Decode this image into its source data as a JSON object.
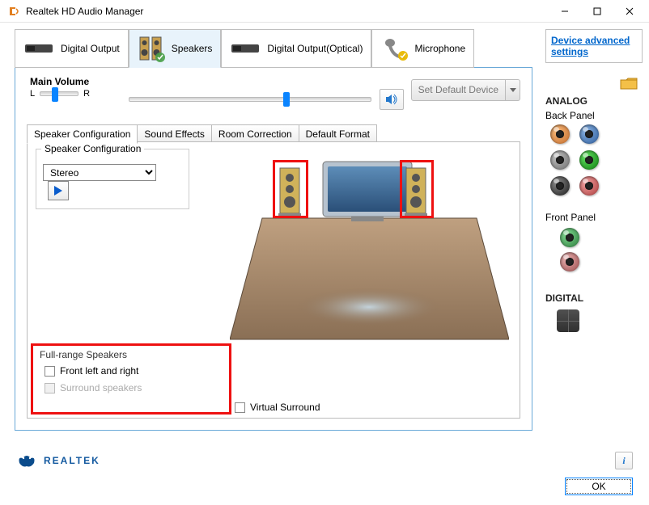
{
  "titlebar": {
    "title": "Realtek HD Audio Manager"
  },
  "device_tabs": [
    {
      "label": "Digital Output",
      "active": false
    },
    {
      "label": "Speakers",
      "active": true
    },
    {
      "label": "Digital Output(Optical)",
      "active": false
    },
    {
      "label": "Microphone",
      "active": false
    }
  ],
  "right": {
    "link": "Device advanced settings",
    "analog_hdr": "ANALOG",
    "back_panel": "Back Panel",
    "front_panel": "Front Panel",
    "digital_hdr": "DIGITAL"
  },
  "volume": {
    "main_label": "Main Volume",
    "left": "L",
    "right": "R",
    "set_default": "Set Default Device"
  },
  "sub_tabs": [
    "Speaker Configuration",
    "Sound Effects",
    "Room Correction",
    "Default Format"
  ],
  "spk_conf": {
    "legend": "Speaker Configuration",
    "selected": "Stereo"
  },
  "full_range": {
    "title": "Full-range Speakers",
    "opt1": "Front left and right",
    "opt2": "Surround speakers"
  },
  "virtual_surround": "Virtual Surround",
  "brand": "REALTEK",
  "ok": "OK"
}
